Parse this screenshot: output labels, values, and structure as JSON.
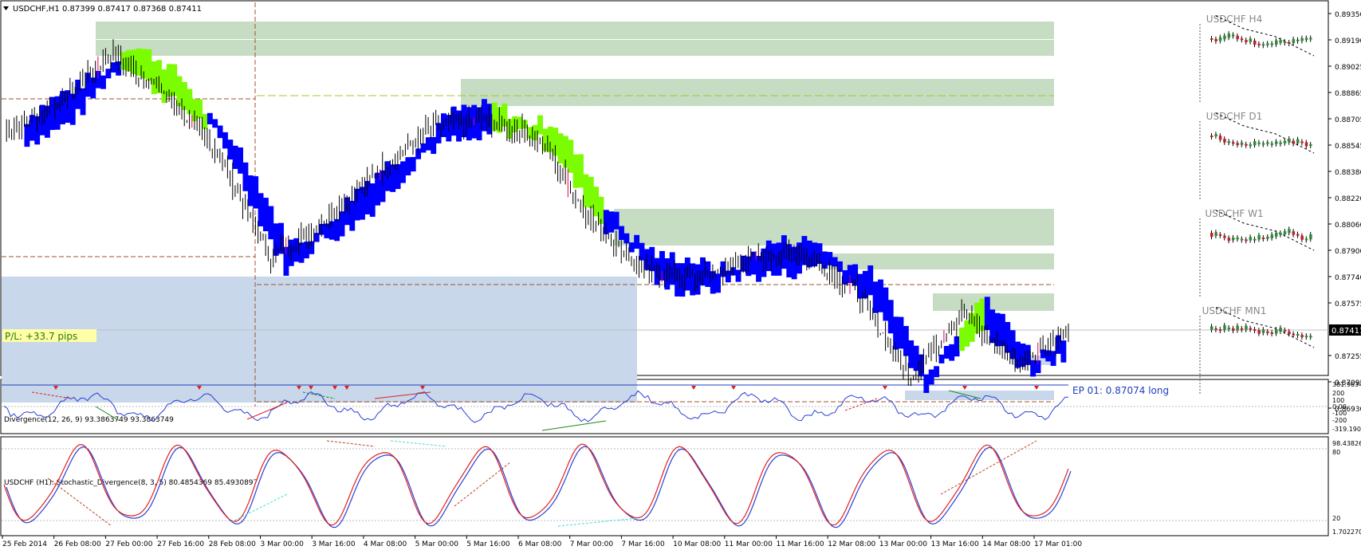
{
  "header": {
    "symbol_tf": "USDCHF,H1",
    "ohlc": "0.87399 0.87417 0.87368 0.87411"
  },
  "main_chart": {
    "price_ticks": [
      "0.89350",
      "0.89190",
      "0.89025",
      "0.88865",
      "0.88705",
      "0.88545",
      "0.88380",
      "0.88220",
      "0.88060",
      "0.87900",
      "0.87740",
      "0.87575",
      "0.87411",
      "0.87255",
      "0.87095",
      "0.86930"
    ],
    "current_price": "0.87411",
    "pl_label": "P/L: +33.7  pips",
    "entry_label": "EP 01:  0.87074     long",
    "colors": {
      "cloud_bull": "#7CFC00",
      "cloud_bear": "#0000FF",
      "zone_green": "#c6dcc3",
      "zone_blue": "#c8d7ea",
      "candle": "#000000",
      "accent_red": "#e0005a"
    }
  },
  "mini_charts": [
    {
      "label": "USDCHF  H4"
    },
    {
      "label": "USDCHF  D1"
    },
    {
      "label": "USDCHF  W1"
    },
    {
      "label": "USDCHF  MN1"
    }
  ],
  "indicator1": {
    "title": "Divergence(12, 26, 9) 93.3863749 93.3863749",
    "ticks": [
      "381.9634",
      "200",
      "100",
      "0.00",
      "-100",
      "-200",
      "-319.1904"
    ]
  },
  "indicator2": {
    "title": "USDCHF (H1):  Stochastic_Divergence(8, 3, 5) 80.4854369 85.4930897",
    "ticks": [
      "98.43826",
      "80",
      "20",
      "1.702270"
    ]
  },
  "time_axis": [
    "25 Feb 2014",
    "26 Feb 08:00",
    "27 Feb 00:00",
    "27 Feb 16:00",
    "28 Feb 08:00",
    "3 Mar 00:00",
    "3 Mar 16:00",
    "4 Mar 08:00",
    "5 Mar 00:00",
    "5 Mar 16:00",
    "6 Mar 08:00",
    "7 Mar 00:00",
    "7 Mar 16:00",
    "10 Mar 08:00",
    "11 Mar 00:00",
    "11 Mar 16:00",
    "12 Mar 08:00",
    "13 Mar 00:00",
    "13 Mar 16:00",
    "14 Mar 08:00",
    "17 Mar 01:00"
  ],
  "chart_data": {
    "type": "candlestick",
    "title": "USDCHF,H1",
    "ylim": [
      0.8693,
      0.8935
    ],
    "series": [
      {
        "name": "USDCHF",
        "x": [
          "25 Feb 2014",
          "26 Feb 08:00",
          "27 Feb 00:00",
          "27 Feb 16:00",
          "28 Feb 08:00",
          "3 Mar 00:00",
          "3 Mar 16:00",
          "4 Mar 08:00",
          "5 Mar 00:00",
          "5 Mar 16:00",
          "6 Mar 08:00",
          "7 Mar 00:00",
          "7 Mar 16:00",
          "10 Mar 08:00",
          "11 Mar 00:00",
          "11 Mar 16:00",
          "12 Mar 08:00",
          "13 Mar 00:00",
          "13 Mar 16:00",
          "14 Mar 08:00",
          "17 Mar 01:00"
        ],
        "values": [
          0.8862,
          0.888,
          0.891,
          0.8887,
          0.885,
          0.8785,
          0.8808,
          0.8837,
          0.8865,
          0.887,
          0.886,
          0.881,
          0.8777,
          0.8772,
          0.8784,
          0.8788,
          0.8766,
          0.8712,
          0.8752,
          0.872,
          0.8741
        ]
      }
    ]
  }
}
